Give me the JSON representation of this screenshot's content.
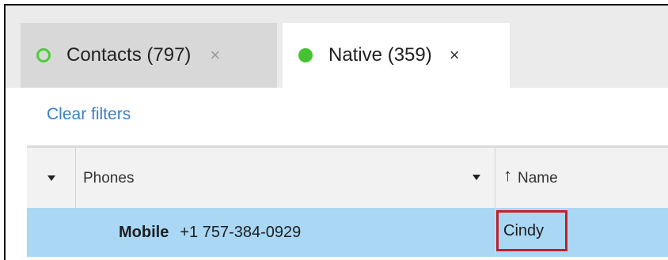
{
  "tabs": [
    {
      "label": "Contacts (797)",
      "close": "×",
      "active": false,
      "dot": "outline-green"
    },
    {
      "label": "Native (359)",
      "close": "×",
      "active": true,
      "dot": "filled-green"
    }
  ],
  "filters": {
    "clear_label": "Clear filters"
  },
  "grid": {
    "columns": [
      {
        "label": "Phones",
        "has_dropdown": true
      },
      {
        "label": "Name",
        "sort": "ascending"
      }
    ],
    "rows": [
      {
        "phone_type": "Mobile",
        "phone_number": "+1 757-384-0929",
        "name": "Cindy",
        "selected": true,
        "highlighted_cell": "name"
      }
    ]
  },
  "colors": {
    "accent_green": "#44c232",
    "link_blue": "#3b7fc4",
    "selection_blue": "#a9d7f4",
    "highlight_red": "#c0202a"
  }
}
